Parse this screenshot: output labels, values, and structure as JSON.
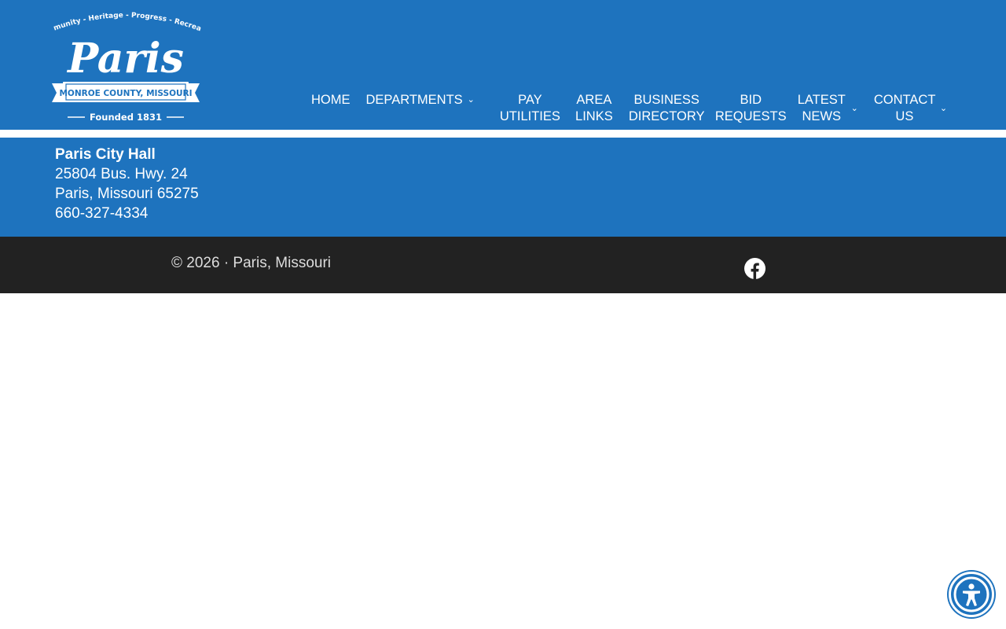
{
  "logo": {
    "arc_text": "Community - Heritage - Progress - Recreation",
    "wordmark": "Paris",
    "banner": "MONROE COUNTY, MISSOURI",
    "founded": "Founded 1831"
  },
  "nav": {
    "items": [
      {
        "label": "HOME",
        "has_dropdown": false
      },
      {
        "label": "DEPARTMENTS",
        "has_dropdown": true
      },
      {
        "label": "PAY UTILITIES",
        "has_dropdown": false
      },
      {
        "label": "AREA LINKS",
        "has_dropdown": false
      },
      {
        "label": "BUSINESS DIRECTORY",
        "has_dropdown": false
      },
      {
        "label": "BID REQUESTS",
        "has_dropdown": false
      },
      {
        "label": "LATEST NEWS",
        "has_dropdown": true
      },
      {
        "label": "CONTACT US",
        "has_dropdown": true
      }
    ]
  },
  "info": {
    "name": "Paris City Hall",
    "address1": "25804 Bus. Hwy. 24",
    "address2": "Paris, Missouri 65275",
    "phone": "660-327-4334"
  },
  "footer": {
    "copyright": "© 2026 · Paris, Missouri"
  },
  "icons": {
    "facebook": "facebook-icon",
    "accessibility": "accessibility-icon",
    "dropdown": "chevron-down-icon"
  },
  "colors": {
    "brand_blue": "#1e73be",
    "footer_bg": "#222222",
    "text_white": "#ffffff"
  }
}
